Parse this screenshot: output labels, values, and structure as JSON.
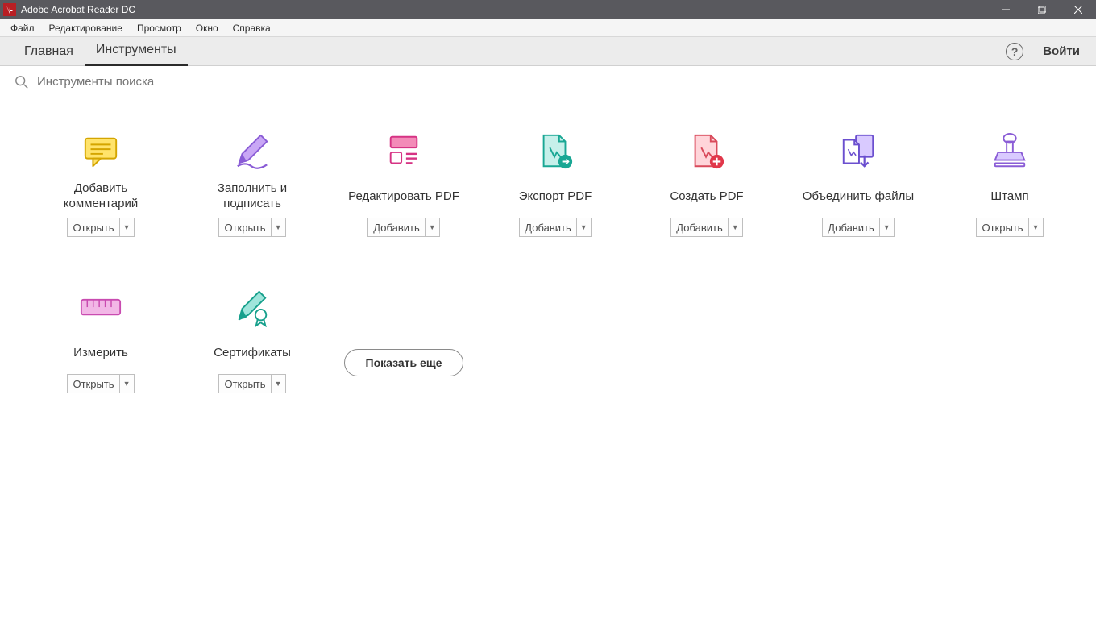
{
  "titlebar": {
    "title": "Adobe Acrobat Reader DC"
  },
  "menubar": {
    "items": [
      "Файл",
      "Редактирование",
      "Просмотр",
      "Окно",
      "Справка"
    ]
  },
  "tabbar": {
    "tabs": [
      {
        "label": "Главная",
        "active": false
      },
      {
        "label": "Инструменты",
        "active": true
      }
    ],
    "login": "Войти"
  },
  "search": {
    "placeholder": "Инструменты поиска"
  },
  "tools": [
    {
      "id": "comment",
      "label": "Добавить\nкомментарий",
      "action": "Открыть"
    },
    {
      "id": "fill-sign",
      "label": "Заполнить и\nподписать",
      "action": "Открыть"
    },
    {
      "id": "edit-pdf",
      "label": "Редактировать PDF",
      "action": "Добавить"
    },
    {
      "id": "export-pdf",
      "label": "Экспорт PDF",
      "action": "Добавить"
    },
    {
      "id": "create-pdf",
      "label": "Создать PDF",
      "action": "Добавить"
    },
    {
      "id": "merge",
      "label": "Объединить файлы",
      "action": "Добавить"
    },
    {
      "id": "stamp",
      "label": "Штамп",
      "action": "Открыть"
    },
    {
      "id": "measure",
      "label": "Измерить",
      "action": "Открыть"
    },
    {
      "id": "cert",
      "label": "Сертификаты",
      "action": "Открыть"
    }
  ],
  "show_more": "Показать еще"
}
